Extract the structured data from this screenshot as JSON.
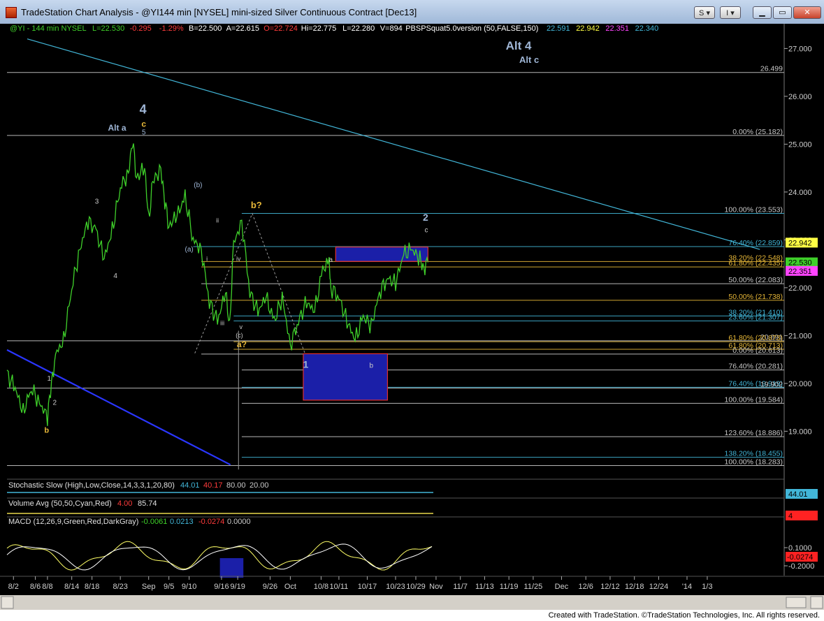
{
  "window": {
    "title": "TradeStation Chart Analysis - @YI144 min [NYSEL] mini-sized Silver Continuous Contract [Dec13]",
    "btn_s": "S",
    "btn_i": "I",
    "dropdown_glyph": "▾",
    "min_glyph": "▁",
    "max_glyph": "▭",
    "close_glyph": "✕"
  },
  "footer": {
    "text": "Created with TradeStation. ©TradeStation Technologies, Inc. All rights reserved."
  },
  "colors": {
    "background": "#000000",
    "price": "#3fd02a",
    "fib": "#c9c9c9",
    "trend": "#42b6d8",
    "blue_box": "#1b1fa8",
    "orange_label": "#e8b838",
    "wave_label": "#9fb6d6"
  },
  "chart_data": {
    "type": "line",
    "symbol_header": "@YI - 144 min  NYSEL",
    "header_values": [
      {
        "text": "L=22.530",
        "color": "#3fd02a"
      },
      {
        "text": "-0.295",
        "color": "#ff3b3b"
      },
      {
        "text": "-1.29%",
        "color": "#ff3b3b"
      },
      {
        "text": "B=22.500",
        "color": "#ffffff"
      },
      {
        "text": "A=22.615",
        "color": "#ffffff"
      },
      {
        "text": "O=22.724",
        "color": "#ff3b3b"
      },
      {
        "text": "Hi=22.775",
        "color": "#ffffff"
      },
      {
        "text": "L=22.280",
        "color": "#ffffff"
      },
      {
        "text": "V=894",
        "color": "#ffffff"
      },
      {
        "text": "PBSPSquat5.0version (50,FALSE,150)",
        "color": "#ffffff"
      },
      {
        "text": "22.591",
        "color": "#42b6d8"
      },
      {
        "text": "22.942",
        "color": "#ffff44"
      },
      {
        "text": "22.351",
        "color": "#ff44ff"
      },
      {
        "text": "22.340",
        "color": "#42b6d8"
      }
    ],
    "y_ticks": [
      "27.000",
      "26.000",
      "25.000",
      "24.000",
      "23.000",
      "22.000",
      "21.000",
      "20.000",
      "19.000"
    ],
    "y_tick_values": [
      27,
      26,
      25,
      24,
      23,
      22,
      21,
      20,
      19
    ],
    "ylim": [
      18.1,
      27.4
    ],
    "x_labels": [
      "8/2",
      "8/6",
      "8/8",
      "8/14",
      "8/18",
      "8/23",
      "Sep",
      "9/5",
      "9/10",
      "9/16",
      "9/19",
      "9/26",
      "Oct",
      "10/8",
      "10/11",
      "10/17",
      "10/23",
      "10/29",
      "Nov",
      "11/7",
      "11/13",
      "11/19",
      "11/25",
      "Dec",
      "12/6",
      "12/12",
      "12/18",
      "12/24",
      "'14",
      "1/3"
    ],
    "x_positions": [
      0.8,
      3.5,
      5,
      8,
      10.5,
      14,
      17.5,
      20,
      22.5,
      26.5,
      28.5,
      32.5,
      35,
      38.8,
      41,
      44.5,
      48,
      50.5,
      53,
      56,
      59,
      62,
      65,
      68.5,
      71.5,
      74.5,
      77.5,
      80.5,
      84,
      86.5
    ],
    "price_path": [
      [
        0,
        20.2
      ],
      [
        1,
        19.9
      ],
      [
        2,
        19.4
      ],
      [
        3,
        19.9
      ],
      [
        4,
        19.6
      ],
      [
        5,
        19.3
      ],
      [
        5.5,
        20.0
      ],
      [
        6,
        20.6
      ],
      [
        7,
        20.9
      ],
      [
        8,
        22.0
      ],
      [
        9,
        22.8
      ],
      [
        10,
        23.4
      ],
      [
        11,
        23.2
      ],
      [
        12,
        22.6
      ],
      [
        13,
        23.2
      ],
      [
        14,
        24.1
      ],
      [
        15,
        24.4
      ],
      [
        15.5,
        25.1
      ],
      [
        16,
        24.3
      ],
      [
        17,
        24.5
      ],
      [
        17.5,
        23.4
      ],
      [
        18,
        24.2
      ],
      [
        19,
        24.5
      ],
      [
        19.5,
        23.8
      ],
      [
        20,
        23.3
      ],
      [
        21,
        23.5
      ],
      [
        22,
        23.9
      ],
      [
        23,
        23.0
      ],
      [
        24,
        22.8
      ],
      [
        25,
        21.7
      ],
      [
        26,
        21.3
      ],
      [
        27,
        21.9
      ],
      [
        27.5,
        21.2
      ],
      [
        28,
        22.9
      ],
      [
        29,
        23.4
      ],
      [
        30,
        21.9
      ],
      [
        31,
        21.5
      ],
      [
        32,
        21.8
      ],
      [
        33,
        21.3
      ],
      [
        34,
        21.8
      ],
      [
        35,
        20.8
      ],
      [
        36,
        21.3
      ],
      [
        37,
        21.7
      ],
      [
        38,
        21.5
      ],
      [
        39,
        22.4
      ],
      [
        39.8,
        22.5
      ],
      [
        40,
        22.0
      ],
      [
        41,
        21.8
      ],
      [
        42,
        21.3
      ],
      [
        43,
        20.9
      ],
      [
        44,
        21.4
      ],
      [
        45,
        21.2
      ],
      [
        46,
        21.9
      ],
      [
        47,
        22.2
      ],
      [
        48,
        22.1
      ],
      [
        49,
        22.7
      ],
      [
        50,
        22.8
      ],
      [
        51,
        22.6
      ],
      [
        51.5,
        22.4
      ],
      [
        52,
        22.53
      ]
    ],
    "last_price": "22.530",
    "price_tags": [
      {
        "label": "22.942",
        "value": 22.942,
        "bg": "#ffff44",
        "fg": "#000000"
      },
      {
        "label": "22.530",
        "value": 22.53,
        "bg": "#3fd02a",
        "fg": "#000000"
      },
      {
        "label": "22.351",
        "value": 22.351,
        "bg": "#ff44ff",
        "fg": "#000000"
      }
    ],
    "fib_lines": [
      {
        "label": "26.499",
        "value": 26.499,
        "x0": 0,
        "color": "#c9c9c9",
        "lc": "#c9c9c9"
      },
      {
        "label": "0.00% (25.182)",
        "value": 25.182,
        "x0": 0,
        "color": "#c9c9c9",
        "lc": "#c9c9c9"
      },
      {
        "label": "100.00% (23.553)",
        "value": 23.553,
        "x0": 29,
        "color": "#c9c9c9",
        "lc": "#42b6d8"
      },
      {
        "label": "76.40% (22.859)",
        "value": 22.859,
        "x0": 23,
        "color": "#42b6d8",
        "lc": "#42b6d8"
      },
      {
        "label": "38.20% (22.548)",
        "value": 22.548,
        "x0": 24,
        "color": "#e8b838",
        "lc": "#e8b838"
      },
      {
        "label": "61.80% (22.435)",
        "value": 22.435,
        "x0": 24,
        "color": "#e8b838",
        "lc": "#e8b838"
      },
      {
        "label": "50.00% (22.083)",
        "value": 22.083,
        "x0": 24,
        "color": "#c9c9c9",
        "lc": "#c9c9c9"
      },
      {
        "label": "50.00% (21.738)",
        "value": 21.738,
        "x0": 24,
        "color": "#e8b838",
        "lc": "#e8b838"
      },
      {
        "label": "38.20% (21.410)",
        "value": 21.41,
        "x0": 28,
        "color": "#42b6d8",
        "lc": "#42b6d8"
      },
      {
        "label": "23.60% (21.307)",
        "value": 21.307,
        "x0": 28,
        "color": "#42b6d8",
        "lc": "#42b6d8"
      },
      {
        "label": "20.891",
        "value": 20.891,
        "x0": 0,
        "color": "#c9c9c9",
        "lc": "#c9c9c9"
      },
      {
        "label": "61.80% (20.873)",
        "value": 20.873,
        "x0": 28,
        "color": "#e8b838",
        "lc": "#e8b838"
      },
      {
        "label": "61.80% (20.713)",
        "value": 20.713,
        "x0": 28,
        "color": "#e8b838",
        "lc": "#e8b838"
      },
      {
        "label": "0.00% (20.613)",
        "value": 20.613,
        "x0": 24,
        "color": "#c9c9c9",
        "lc": "#c9c9c9"
      },
      {
        "label": "76.40% (20.281)",
        "value": 20.281,
        "x0": 29,
        "color": "#c9c9c9",
        "lc": "#c9c9c9"
      },
      {
        "label": "76.40% (19.919)",
        "value": 19.919,
        "x0": 29,
        "color": "#42b6d8",
        "lc": "#42b6d8"
      },
      {
        "label": "19.902",
        "value": 19.902,
        "x0": 0,
        "color": "#c9c9c9",
        "lc": "#c9c9c9"
      },
      {
        "label": "100.00% (19.584)",
        "value": 19.584,
        "x0": 29,
        "color": "#c9c9c9",
        "lc": "#c9c9c9"
      },
      {
        "label": "123.60% (18.886)",
        "value": 18.886,
        "x0": 29,
        "color": "#c9c9c9",
        "lc": "#c9c9c9"
      },
      {
        "label": "138.20% (18.455)",
        "value": 18.455,
        "x0": 29,
        "color": "#42b6d8",
        "lc": "#42b6d8"
      },
      {
        "label": "100.00% (18.283)",
        "value": 18.283,
        "x0": 0,
        "color": "#c9c9c9",
        "lc": "#c9c9c9"
      }
    ],
    "wave_labels": [
      {
        "text": "Alt 4",
        "x": 63.2,
        "y": 26.98,
        "color": "#9fb6d6",
        "size": 17,
        "bold": true
      },
      {
        "text": "Alt c",
        "x": 64.5,
        "y": 26.7,
        "color": "#9fb6d6",
        "size": 13,
        "bold": true
      },
      {
        "text": "4",
        "x": 16.8,
        "y": 25.64,
        "color": "#9fb6d6",
        "size": 18,
        "bold": true
      },
      {
        "text": "c",
        "x": 16.9,
        "y": 25.36,
        "color": "#e8b838",
        "size": 12,
        "bold": true
      },
      {
        "text": "5",
        "x": 16.9,
        "y": 25.2,
        "color": "#9fb6d6",
        "size": 10,
        "bold": false
      },
      {
        "text": "Alt a",
        "x": 13.6,
        "y": 25.28,
        "color": "#9fb6d6",
        "size": 12,
        "bold": true
      },
      {
        "text": "3",
        "x": 11.1,
        "y": 23.76,
        "color": "#c9c9c9",
        "size": 10,
        "bold": false
      },
      {
        "text": "4",
        "x": 13.4,
        "y": 22.2,
        "color": "#c9c9c9",
        "size": 10,
        "bold": false
      },
      {
        "text": "(b)",
        "x": 23.6,
        "y": 24.1,
        "color": "#9fb6d6",
        "size": 10,
        "bold": false
      },
      {
        "text": "(a)",
        "x": 22.5,
        "y": 22.76,
        "color": "#9fb6d6",
        "size": 10,
        "bold": false
      },
      {
        "text": "ii",
        "x": 26.0,
        "y": 23.36,
        "color": "#c9c9c9",
        "size": 9,
        "bold": false
      },
      {
        "text": "i",
        "x": 24.7,
        "y": 22.56,
        "color": "#c9c9c9",
        "size": 9,
        "bold": false
      },
      {
        "text": "iii",
        "x": 26.6,
        "y": 21.22,
        "color": "#c9c9c9",
        "size": 9,
        "bold": false
      },
      {
        "text": "iv",
        "x": 28.6,
        "y": 22.56,
        "color": "#c9c9c9",
        "size": 9,
        "bold": false
      },
      {
        "text": "v",
        "x": 28.9,
        "y": 21.14,
        "color": "#c9c9c9",
        "size": 9,
        "bold": false
      },
      {
        "text": "(c)",
        "x": 28.7,
        "y": 20.96,
        "color": "#c9c9c9",
        "size": 9,
        "bold": false
      },
      {
        "text": "b?",
        "x": 30.8,
        "y": 23.66,
        "color": "#e8b838",
        "size": 13,
        "bold": true
      },
      {
        "text": "a?",
        "x": 29.0,
        "y": 20.76,
        "color": "#e8b838",
        "size": 12,
        "bold": true
      },
      {
        "text": "1",
        "x": 36.9,
        "y": 20.33,
        "color": "#9fb6d6",
        "size": 14,
        "bold": true
      },
      {
        "text": "a",
        "x": 40.0,
        "y": 22.54,
        "color": "#c9c9c9",
        "size": 10,
        "bold": false
      },
      {
        "text": "b",
        "x": 45.0,
        "y": 20.33,
        "color": "#c9c9c9",
        "size": 10,
        "bold": false
      },
      {
        "text": "2",
        "x": 51.7,
        "y": 23.4,
        "color": "#9fb6d6",
        "size": 14,
        "bold": true
      },
      {
        "text": "c",
        "x": 51.8,
        "y": 23.16,
        "color": "#c9c9c9",
        "size": 10,
        "bold": false
      },
      {
        "text": "1",
        "x": 5.2,
        "y": 20.06,
        "color": "#c9c9c9",
        "size": 10,
        "bold": false
      },
      {
        "text": "2",
        "x": 5.9,
        "y": 19.55,
        "color": "#c9c9c9",
        "size": 10,
        "bold": false
      },
      {
        "text": "b",
        "x": 4.9,
        "y": 18.97,
        "color": "#e8b838",
        "size": 11,
        "bold": true
      }
    ],
    "trendlines": [
      {
        "x0": 2.5,
        "y0": 27.2,
        "x1": 93,
        "y1": 22.8,
        "color": "#42b6d8",
        "width": 1.2
      },
      {
        "x0": 0,
        "y0": 20.7,
        "x1": 27.6,
        "y1": 18.3,
        "color": "#2a36ff",
        "width": 2.2
      }
    ],
    "blue_boxes": [
      {
        "x0": 40.6,
        "x1": 52,
        "y0": 22.55,
        "y1": 22.85,
        "border": "#e03030"
      },
      {
        "x0": 36.6,
        "x1": 47.0,
        "y0": 19.65,
        "y1": 20.62,
        "border": "#e03030"
      }
    ],
    "subpanels": {
      "stochastic": {
        "label": "Stochastic Slow (High,Low,Close,14,3,3,1,20,80)",
        "v1": "44.01",
        "v2": "40.17",
        "v3": "80.00",
        "v4": "20.00",
        "last": "44.01"
      },
      "volume": {
        "label": "Volume Avg (50,50,Cyan,Red)",
        "v1": "4.00",
        "v2": "85.74",
        "last": "4"
      },
      "macd": {
        "label": "MACD (12,26,9,Green,Red,DarkGray)",
        "v1": "-0.0061",
        "v2": "0.0213",
        "v3": "-0.0274",
        "v4": "0.0000",
        "tick_top": "0.1000",
        "tick_bottom": "-0.2000",
        "last": "-0.0274"
      }
    }
  }
}
